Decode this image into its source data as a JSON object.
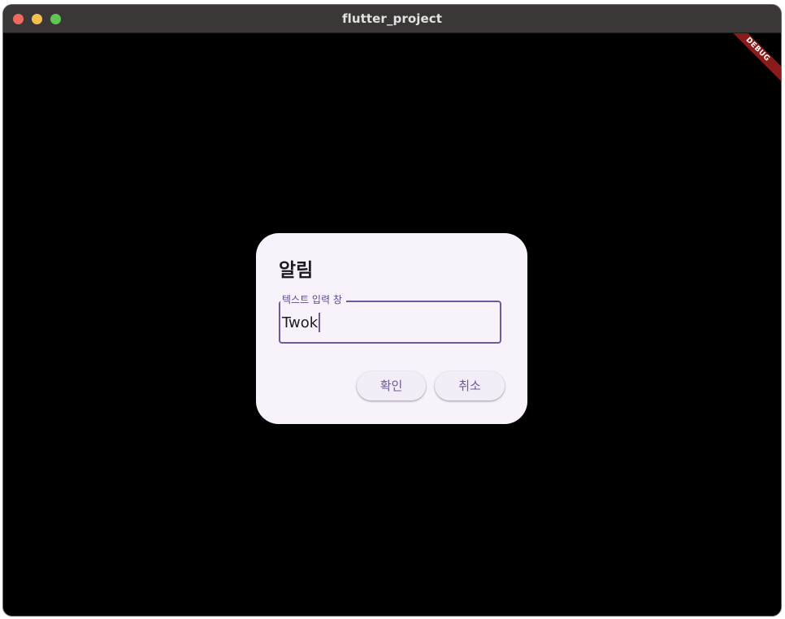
{
  "window": {
    "title": "flutter_project"
  },
  "debug_banner": {
    "label": "DEBUG"
  },
  "dialog": {
    "title": "알림",
    "field": {
      "label": "텍스트 입력 창",
      "value": "Twok"
    },
    "buttons": {
      "confirm_label": "확인",
      "cancel_label": "취소"
    }
  },
  "colors": {
    "dialog_background": "#f8f2fb",
    "accent": "#6c5a9a",
    "debug_ribbon": "#8a1b1b",
    "titlebar": "#3b3737"
  }
}
